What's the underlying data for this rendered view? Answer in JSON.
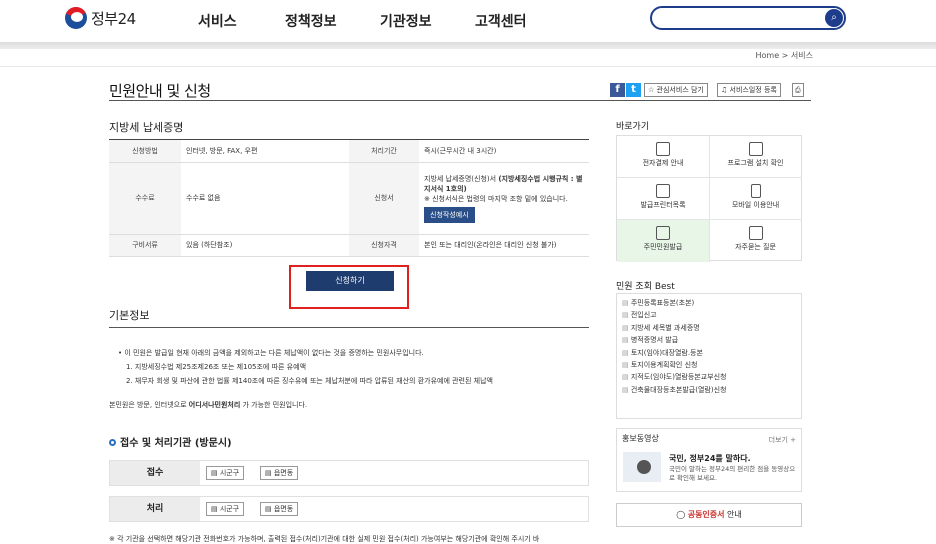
{
  "header": {
    "logo_text": "정부24",
    "nav": [
      "서비스",
      "정책정보",
      "기관정보",
      "고객센터"
    ],
    "search_placeholder": ""
  },
  "breadcrumb": "Home > 서비스",
  "page_title": "민원안내 및 신청",
  "top_buttons": {
    "fav": "관심서비스 담기",
    "schedule": "서비스일정 등록"
  },
  "section1_title": "지방세 납세증명",
  "table": {
    "r1": {
      "h1": "신청방법",
      "v1": "인터넷, 방문, FAX, 우편",
      "h2": "처리기간",
      "v2": "즉시(근무시간 내 3시간)"
    },
    "r2": {
      "h1": "수수료",
      "v1": "수수료 없음",
      "h2": "신청서",
      "v2a": "지방세 납세증명(신청)서 ",
      "v2b": "(지방세징수법 시행규칙 : 별지서식 1호의)",
      "v2c": "※ 신청서식은 법령의 마지막 조항 밑에 있습니다.",
      "form_btn": "신청작성예시"
    },
    "r3": {
      "h1": "구비서류",
      "v1": "있음 (하단참조)",
      "h2": "신청자격",
      "v2": "본인 또는 대리인(온라인은 대리인 신청 불가)"
    }
  },
  "apply_button": "신청하기",
  "basic_title": "기본정보",
  "basic": {
    "l1": "• 이 민원은 발급일 현재 아래의 금액을 제외하고는 다른 체납액이 없다는 것을 증명하는 민원사무입니다.",
    "l2": "1. 지방세징수법 제25조제26조 또는 제105조에 따른 유예액",
    "l3": "2. 채무자 회생 및 파산에 관한 법률 제140조에 따른 징수유예 또는 체납처분에 따라 압류된 재산의 환가유예에 관련된 체납액",
    "l4a": "본민원은 방문, 인터넷으로 ",
    "l4b": "어디서나민원처리",
    "l4c": " 가 가능한 민원입니다."
  },
  "recv_title": "접수 및 처리기관 (방문시)",
  "recv": {
    "label": "접수",
    "chip1": "시군구",
    "chip2": "읍면동"
  },
  "proc": {
    "label": "처리",
    "chip1": "시군구",
    "chip2": "읍면동"
  },
  "bottom_text": "※ 각 기관을 선택하면 해당기관 전화번호가 가능하며, 출력된 접수(처리)기관에 대한 실제 민원 접수(처리) 가능여부는 해당기관에 확인해 주시기 바",
  "quick_title": "바로가기",
  "quick": [
    "전자결제 안내",
    "프로그램 설치 확인",
    "발급프린터목록",
    "모바일 이용안내",
    "주민민원발급",
    "자주묻는 질문"
  ],
  "best_title": "민원 조회 Best",
  "best": [
    "주민등록표등본(초본)",
    "전입신고",
    "지방세 세목별 과세증명",
    "병적증명서 발급",
    "토지(임야)대장열람.등본",
    "토지이용계획확인 신청",
    "지적도(임야도)열람등본교부신청",
    "건축물대장등초본발급(열람)신청"
  ],
  "promo": {
    "title": "홍보동영상",
    "more": "더보기 +",
    "headline": "국민, 정부24를 말하다.",
    "desc": "국민이 말하는 정부24의 편리한 점을 동영상으로 확인해 보세요."
  },
  "cert": {
    "a": "공동인증서",
    "b": " 안내"
  }
}
